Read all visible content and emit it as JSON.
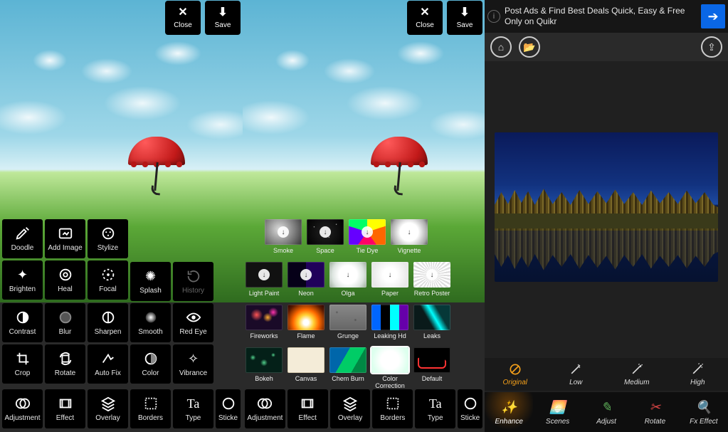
{
  "topbuttons": {
    "close": "Close",
    "save": "Save"
  },
  "pane1": {
    "topTiles": [
      "Doodle",
      "Add Image",
      "Stylize",
      "Brighten",
      "Heal",
      "Focal"
    ],
    "extraTiles": [
      "Splash",
      "History"
    ],
    "midTiles": [
      "Contrast",
      "Blur",
      "Sharpen",
      "Smooth",
      "Red Eye",
      "Crop",
      "Rotate",
      "Auto Fix",
      "Color",
      "Vibrance"
    ],
    "strip": [
      "Adjustment",
      "Effect",
      "Overlay",
      "Borders",
      "Type",
      "Sticke"
    ]
  },
  "pane2": {
    "row1": [
      "Smoke",
      "Space",
      "Tie Dye",
      "Vignette"
    ],
    "row2": [
      "Light Paint",
      "Neon",
      "Olga",
      "Paper",
      "Retro Poster"
    ],
    "row3": [
      "Fireworks",
      "Flame",
      "Grunge",
      "Leaking Hd",
      "Leaks"
    ],
    "row4": [
      "Bokeh",
      "Canvas",
      "Chem Burn",
      "Color Correction",
      "Default"
    ],
    "selected": "Color Correction",
    "strip": [
      "Adjustment",
      "Effect",
      "Overlay",
      "Borders",
      "Type",
      "Sticke"
    ]
  },
  "pane3": {
    "adText": "Post Ads & Find Best Deals Quick, Easy & Free Only on Quikr",
    "levels": [
      "Original",
      "Low",
      "Medium",
      "High"
    ],
    "activeLevel": "Original",
    "nav": [
      "Enhance",
      "Scenes",
      "Adjust",
      "Rotate",
      "Fx Effect"
    ],
    "activeNav": "Enhance"
  }
}
